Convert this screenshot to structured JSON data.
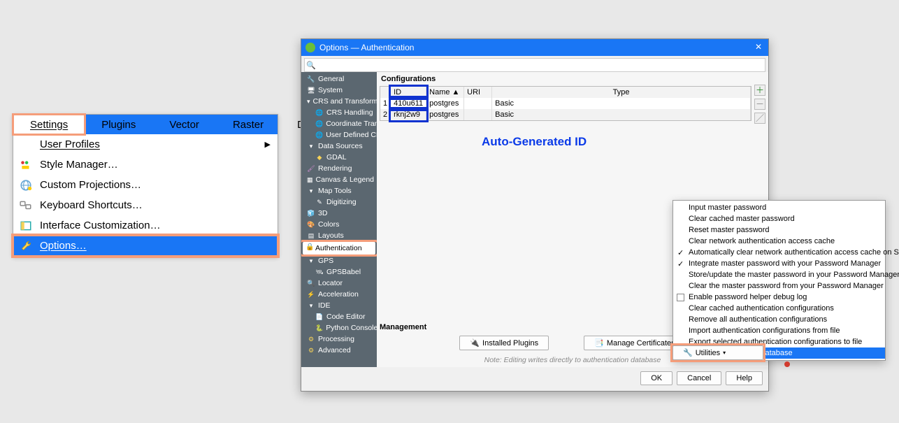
{
  "menubar": {
    "settings": "Settings",
    "plugins": "Plugins",
    "vector": "Vector",
    "raster": "Raster",
    "datab": "Datab"
  },
  "settings_menu": {
    "user_profiles": "User Profiles",
    "style_manager": "Style Manager…",
    "custom_projections": "Custom Projections…",
    "keyboard_shortcuts": "Keyboard Shortcuts…",
    "interface_customization": "Interface Customization…",
    "options": "Options…"
  },
  "dialog": {
    "title": "Options — Authentication",
    "search_placeholder": "",
    "nav": {
      "general": "General",
      "system": "System",
      "crs_transforms": "CRS and Transforms",
      "crs_handling": "CRS Handling",
      "coordinate_trans": "Coordinate Trans",
      "user_defined_crs": "User Defined CR",
      "data_sources": "Data Sources",
      "gdal": "GDAL",
      "rendering": "Rendering",
      "canvas_legend": "Canvas & Legend",
      "map_tools": "Map Tools",
      "digitizing": "Digitizing",
      "three_d": "3D",
      "colors": "Colors",
      "layouts": "Layouts",
      "authentication": "Authentication",
      "gps": "GPS",
      "gpsbabel": "GPSBabel",
      "locator": "Locator",
      "acceleration": "Acceleration",
      "ide": "IDE",
      "code_editor": "Code Editor",
      "python_console": "Python Console",
      "processing": "Processing",
      "advanced": "Advanced"
    },
    "main": {
      "configurations_title": "Configurations",
      "auto_gen_label": "Auto-Generated ID",
      "columns": {
        "row": "",
        "id": "ID",
        "name": "Name",
        "arrow": "▲",
        "uri": "URI",
        "type": "Type"
      },
      "rows": [
        {
          "n": "1",
          "id": "410u611",
          "name": "postgres",
          "uri": "",
          "type": "Basic"
        },
        {
          "n": "2",
          "id": "rknj2w9",
          "name": "postgres",
          "uri": "",
          "type": "Basic"
        }
      ],
      "management_title": "Management",
      "installed_plugins": "Installed Plugins",
      "manage_certificates": "Manage Certificates",
      "utilities": "Utilities",
      "hint": "Note: Editing writes directly to authentication database",
      "ok": "OK",
      "cancel": "Cancel",
      "help": "Help"
    }
  },
  "utilities_menu": {
    "items": [
      {
        "label": "Input master password"
      },
      {
        "label": "Clear cached master password"
      },
      {
        "label": "Reset master password"
      },
      {
        "label": "Clear network authentication access cache"
      },
      {
        "label": "Automatically clear network authentication access cache on SSL errors",
        "check": true
      },
      {
        "label": "Integrate master password with your Password Manager",
        "check": true
      },
      {
        "label": "Store/update the master password in your Password Manager"
      },
      {
        "label": "Clear the master password from your Password Manager"
      },
      {
        "label": "Enable password helper debug log",
        "box": true
      },
      {
        "label": "Clear cached authentication configurations"
      },
      {
        "label": "Remove all authentication configurations"
      },
      {
        "label": "Import authentication configurations from file"
      },
      {
        "label": "Export selected authentication configurations to file"
      },
      {
        "label": "Erase authentication database",
        "selected": true
      }
    ]
  }
}
